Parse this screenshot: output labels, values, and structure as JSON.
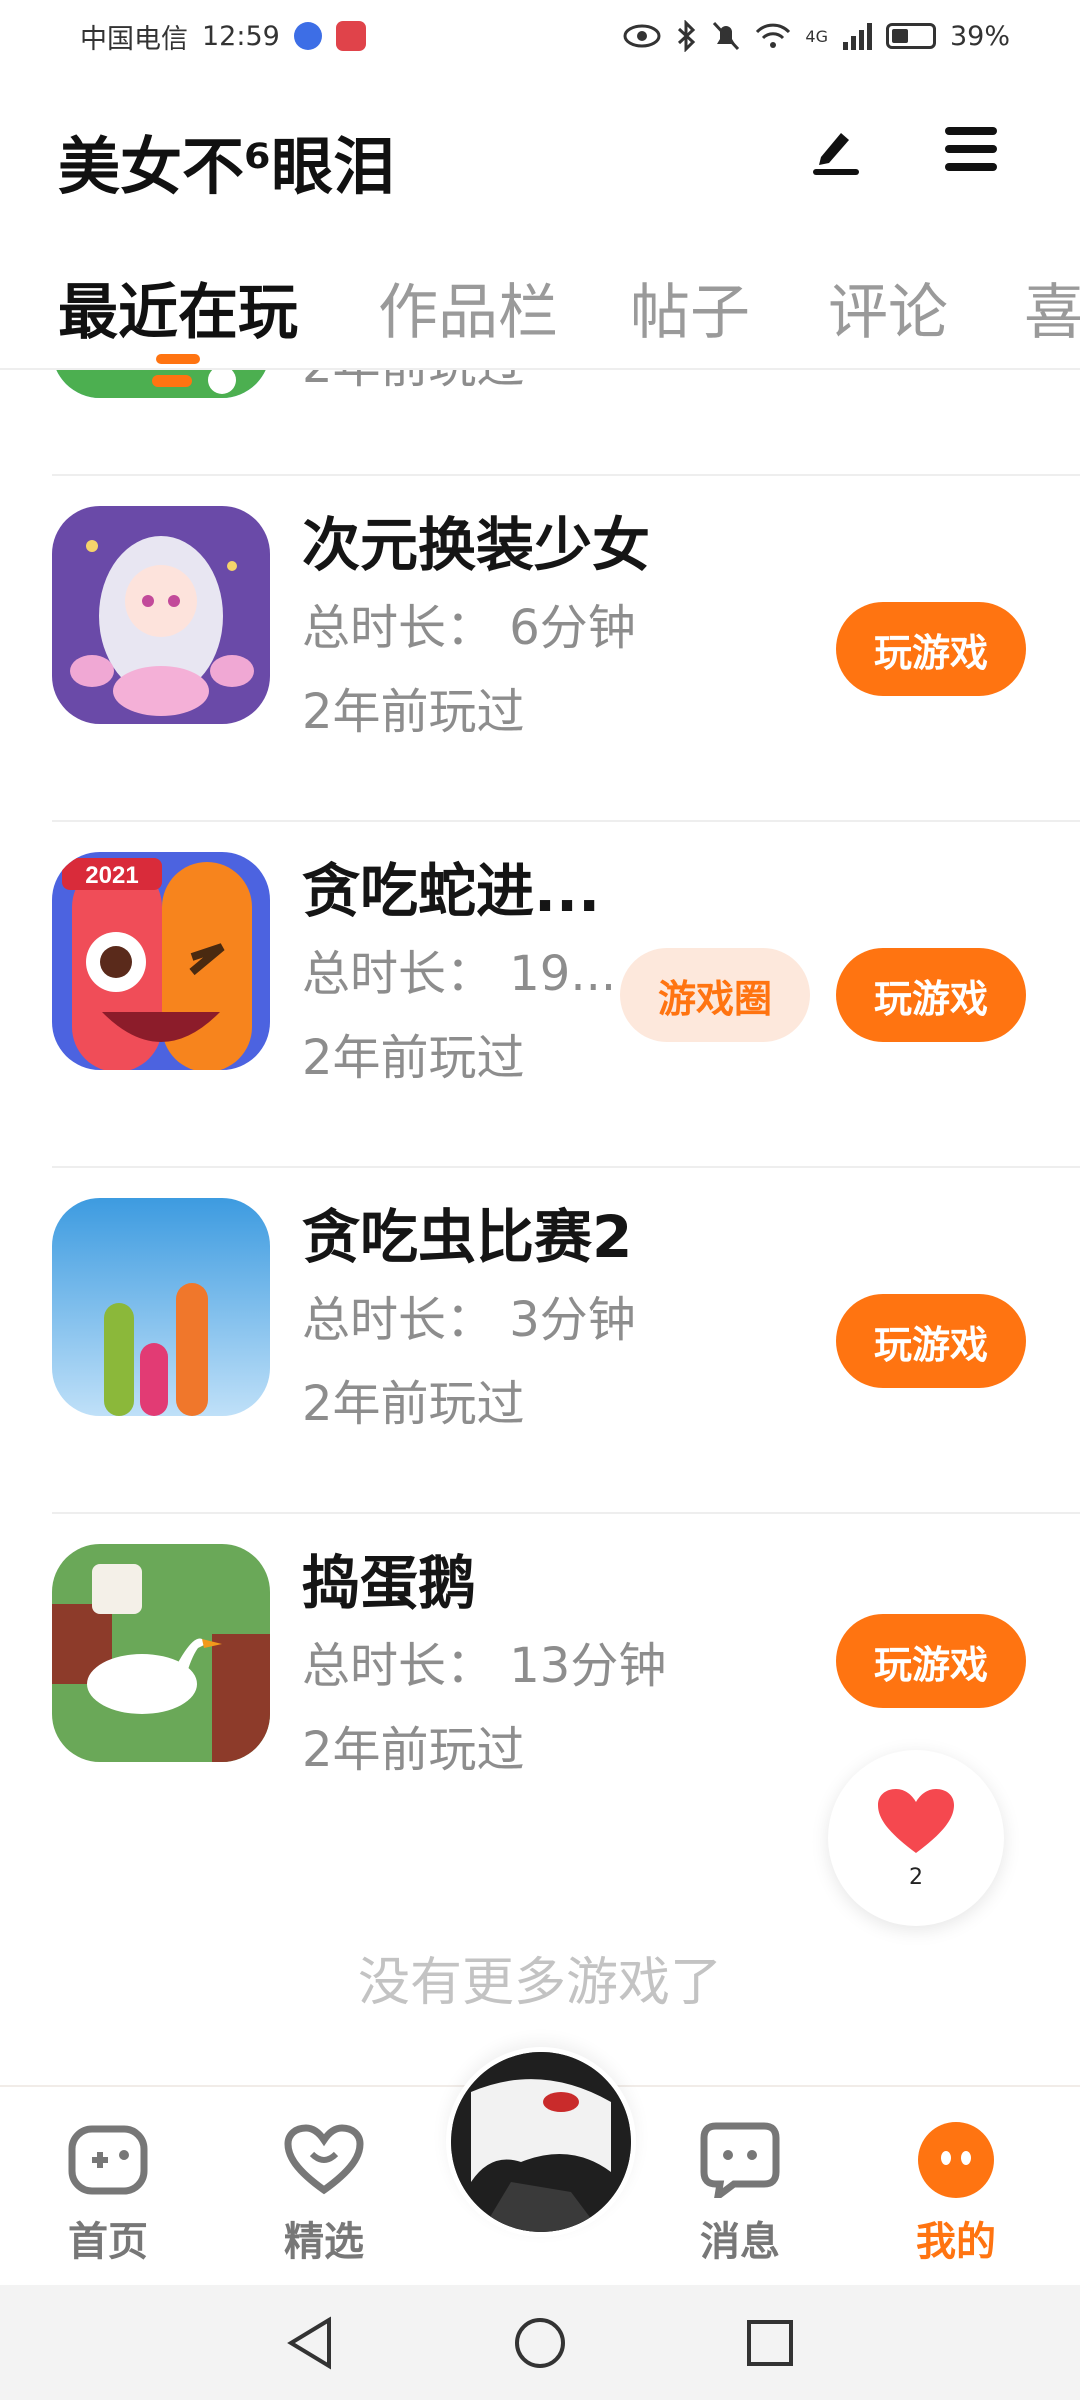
{
  "status_bar": {
    "carrier": "中国电信",
    "time": "12:59",
    "network": "4G",
    "battery": "39%"
  },
  "header": {
    "username": "美女不⁶眼泪"
  },
  "tabs": [
    {
      "label": "最近在玩",
      "active": true
    },
    {
      "label": "作品栏",
      "active": false
    },
    {
      "label": "帖子",
      "active": false
    },
    {
      "label": "评论",
      "active": false
    },
    {
      "label": "喜",
      "active": false
    }
  ],
  "games": [
    {
      "name": "",
      "duration": "",
      "last_played": "2年前玩过",
      "play_label": ""
    },
    {
      "name": "次元换装少女",
      "duration": "总时长：  6分钟",
      "last_played": "2年前玩过",
      "play_label": "玩游戏"
    },
    {
      "name": "贪吃蛇进...",
      "duration": "总时长：  19...",
      "last_played": "2年前玩过",
      "play_label": "玩游戏",
      "circle_label": "游戏圈"
    },
    {
      "name": "贪吃虫比赛2",
      "duration": "总时长：  3分钟",
      "last_played": "2年前玩过",
      "play_label": "玩游戏"
    },
    {
      "name": "捣蛋鹅",
      "duration": "总时长：  13分钟",
      "last_played": "2年前玩过",
      "play_label": "玩游戏"
    }
  ],
  "icon_badges": {
    "snake_year": "2021"
  },
  "like_bubble": {
    "count": "2"
  },
  "list_end_text": "没有更多游戏了",
  "bottom_nav": [
    {
      "label": "首页",
      "icon": "gamepad-icon",
      "active": false
    },
    {
      "label": "精选",
      "icon": "heart-outline-icon",
      "active": false
    },
    {
      "label": "消息",
      "icon": "chat-bubble-icon",
      "active": false
    },
    {
      "label": "我的",
      "icon": "profile-face-icon",
      "active": true
    }
  ],
  "colors": {
    "accent": "#ff7411",
    "accent_light": "#fde8dc",
    "text_primary": "#111111",
    "text_secondary": "#8d8d8d"
  }
}
